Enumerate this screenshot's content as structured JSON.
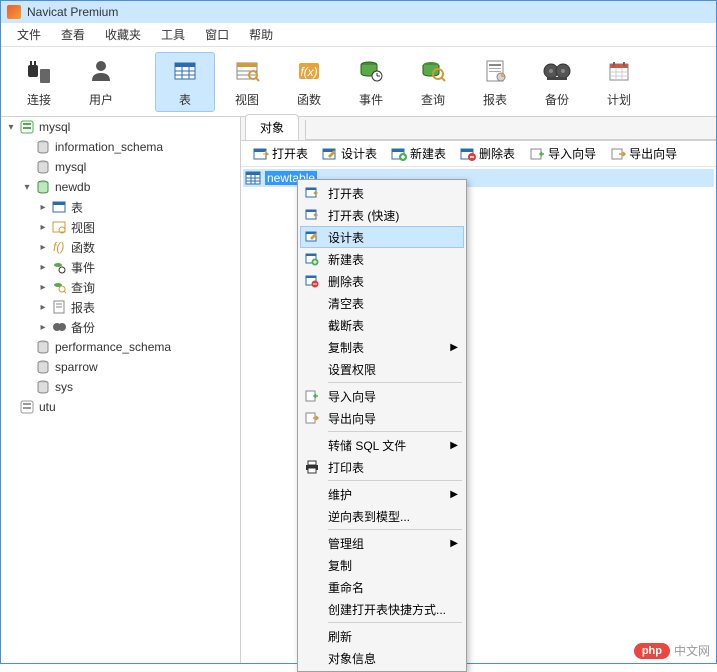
{
  "title_bar": {
    "app_name": "Navicat Premium"
  },
  "menu_bar": {
    "items": [
      "文件",
      "查看",
      "收藏夹",
      "工具",
      "窗口",
      "帮助"
    ]
  },
  "toolbar": {
    "connect": "连接",
    "user": "用户",
    "table": "表",
    "view": "视图",
    "function": "函数",
    "event": "事件",
    "query": "查询",
    "report": "报表",
    "backup": "备份",
    "plan": "计划"
  },
  "sidebar": {
    "nodes": [
      {
        "label": "mysql",
        "depth": 0,
        "toggle": "▾",
        "icon": "server-green"
      },
      {
        "label": "information_schema",
        "depth": 1,
        "toggle": "",
        "icon": "db"
      },
      {
        "label": "mysql",
        "depth": 1,
        "toggle": "",
        "icon": "db"
      },
      {
        "label": "newdb",
        "depth": 1,
        "toggle": "▾",
        "icon": "db-open"
      },
      {
        "label": "表",
        "depth": 2,
        "toggle": "▸",
        "icon": "table"
      },
      {
        "label": "视图",
        "depth": 2,
        "toggle": "▸",
        "icon": "view"
      },
      {
        "label": "函数",
        "depth": 2,
        "toggle": "▸",
        "icon": "fx"
      },
      {
        "label": "事件",
        "depth": 2,
        "toggle": "▸",
        "icon": "event"
      },
      {
        "label": "查询",
        "depth": 2,
        "toggle": "▸",
        "icon": "query"
      },
      {
        "label": "报表",
        "depth": 2,
        "toggle": "▸",
        "icon": "report"
      },
      {
        "label": "备份",
        "depth": 2,
        "toggle": "▸",
        "icon": "backup"
      },
      {
        "label": "performance_schema",
        "depth": 1,
        "toggle": "",
        "icon": "db"
      },
      {
        "label": "sparrow",
        "depth": 1,
        "toggle": "",
        "icon": "db"
      },
      {
        "label": "sys",
        "depth": 1,
        "toggle": "",
        "icon": "db"
      },
      {
        "label": "utu",
        "depth": 0,
        "toggle": "",
        "icon": "server-gray"
      }
    ]
  },
  "tabs": {
    "objects": "对象"
  },
  "action_bar": {
    "open_table": "打开表",
    "design_table": "设计表",
    "new_table": "新建表",
    "delete_table": "删除表",
    "import_wizard": "导入向导",
    "export_wizard": "导出向导"
  },
  "list": {
    "items": [
      {
        "label": "newtable",
        "selected": true
      }
    ]
  },
  "context_menu": {
    "items": [
      {
        "label": "打开表",
        "icon": "open",
        "type": "item"
      },
      {
        "label": "打开表 (快速)",
        "icon": "open",
        "type": "item"
      },
      {
        "label": "设计表",
        "icon": "design",
        "type": "item",
        "hover": true
      },
      {
        "label": "新建表",
        "icon": "new",
        "type": "item"
      },
      {
        "label": "删除表",
        "icon": "delete",
        "type": "item"
      },
      {
        "label": "清空表",
        "icon": "",
        "type": "item"
      },
      {
        "label": "截断表",
        "icon": "",
        "type": "item"
      },
      {
        "label": "复制表",
        "icon": "",
        "type": "submenu"
      },
      {
        "label": "设置权限",
        "icon": "",
        "type": "item"
      },
      {
        "type": "sep"
      },
      {
        "label": "导入向导",
        "icon": "import",
        "type": "item"
      },
      {
        "label": "导出向导",
        "icon": "export",
        "type": "item"
      },
      {
        "type": "sep"
      },
      {
        "label": "转储 SQL 文件",
        "icon": "",
        "type": "submenu"
      },
      {
        "label": "打印表",
        "icon": "print",
        "type": "item"
      },
      {
        "type": "sep"
      },
      {
        "label": "维护",
        "icon": "",
        "type": "submenu"
      },
      {
        "label": "逆向表到模型...",
        "icon": "",
        "type": "item"
      },
      {
        "type": "sep"
      },
      {
        "label": "管理组",
        "icon": "",
        "type": "submenu"
      },
      {
        "label": "复制",
        "icon": "",
        "type": "item"
      },
      {
        "label": "重命名",
        "icon": "",
        "type": "item"
      },
      {
        "label": "创建打开表快捷方式...",
        "icon": "",
        "type": "item"
      },
      {
        "type": "sep"
      },
      {
        "label": "刷新",
        "icon": "",
        "type": "item"
      },
      {
        "label": "对象信息",
        "icon": "",
        "type": "item"
      }
    ]
  },
  "watermark": {
    "badge": "php",
    "text": "中文网"
  }
}
